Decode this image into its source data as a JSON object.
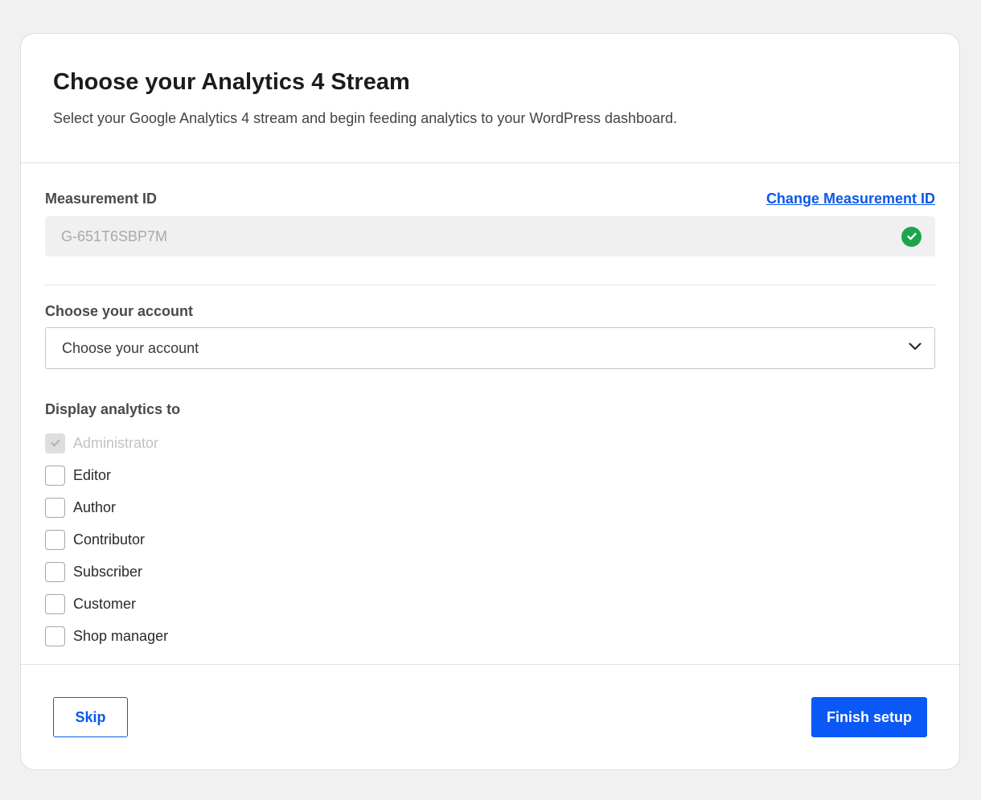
{
  "header": {
    "title": "Choose your Analytics 4 Stream",
    "subtitle": "Select your Google Analytics 4 stream and begin feeding analytics to your WordPress dashboard."
  },
  "measurement": {
    "label": "Measurement ID",
    "change_link": "Change Measurement ID",
    "value": "G-651T6SBP7M",
    "status_icon": "check-circle-icon",
    "status_color": "#1ea54b"
  },
  "account": {
    "label": "Choose your account",
    "selected": "Choose your account",
    "icon": "chevron-down-icon"
  },
  "display": {
    "label": "Display analytics to",
    "roles": [
      {
        "label": "Administrator",
        "checked": true,
        "disabled": true
      },
      {
        "label": "Editor",
        "checked": false,
        "disabled": false
      },
      {
        "label": "Author",
        "checked": false,
        "disabled": false
      },
      {
        "label": "Contributor",
        "checked": false,
        "disabled": false
      },
      {
        "label": "Subscriber",
        "checked": false,
        "disabled": false
      },
      {
        "label": "Customer",
        "checked": false,
        "disabled": false
      },
      {
        "label": "Shop manager",
        "checked": false,
        "disabled": false
      }
    ]
  },
  "footer": {
    "skip_label": "Skip",
    "finish_label": "Finish setup"
  },
  "colors": {
    "accent": "#0a58f6",
    "link": "#0a58e6",
    "success": "#1ea54b"
  }
}
